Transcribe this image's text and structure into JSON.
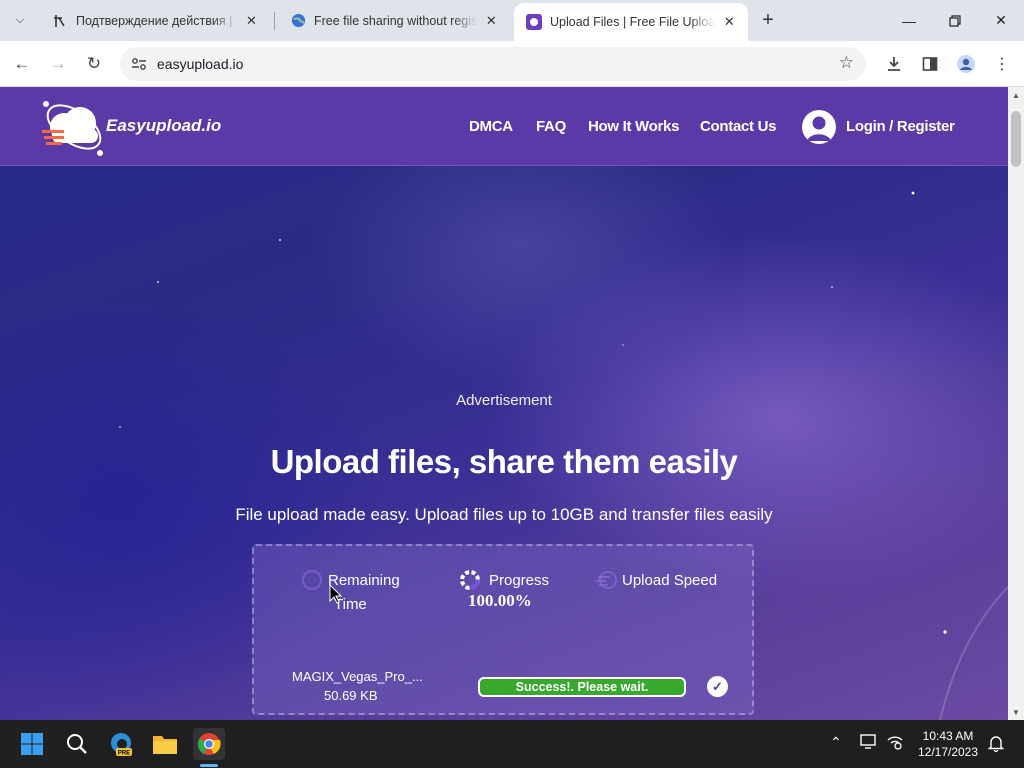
{
  "browser": {
    "tabs": [
      {
        "title": "Подтверждение действия | BL"
      },
      {
        "title": "Free file sharing without registr"
      },
      {
        "title": "Upload Files | Free File Upload s"
      }
    ],
    "url": "easyupload.io"
  },
  "site": {
    "logo_text": "Easyupload.io",
    "nav": [
      "DMCA",
      "FAQ",
      "How It Works",
      "Contact Us"
    ],
    "login_label": "Login / Register"
  },
  "hero": {
    "advertisement": "Advertisement",
    "title": "Upload files, share them easily",
    "subtitle": "File upload made easy. Upload files up to 10GB and transfer files easily"
  },
  "upload_card": {
    "remaining_time_label_line1": "Remaining",
    "remaining_time_label_line2": "Time",
    "progress_label": "Progress",
    "progress_value": "100.00%",
    "progress_fraction": 1.0,
    "upload_speed_label": "Upload Speed",
    "file_name": "MAGIX_Vegas_Pro_...",
    "file_size": "50.69 KB",
    "status_text": "Success!. Please wait."
  },
  "taskbar": {
    "time": "10:43 AM",
    "date": "12/17/2023"
  },
  "colors": {
    "brand_purple": "#5b3aa8",
    "success_green": "#38a82e"
  }
}
